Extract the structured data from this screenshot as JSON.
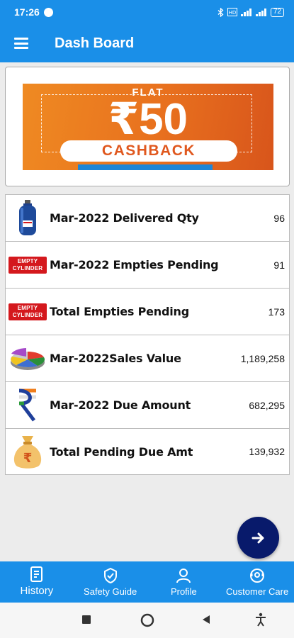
{
  "status": {
    "time": "17:26",
    "battery": "72"
  },
  "appbar": {
    "title": "Dash Board"
  },
  "banner": {
    "flat": "FLAT",
    "amount": "₹50",
    "cashback": "CASHBACK"
  },
  "empty_badge": {
    "line1": "EMPTY",
    "line2": "CYLINDER"
  },
  "rows": [
    {
      "label": "Mar-2022 Delivered Qty",
      "value": "96",
      "icon": "gas-cylinder-icon"
    },
    {
      "label": "Mar-2022 Empties Pending",
      "value": "91",
      "icon": "empty-cylinder-icon"
    },
    {
      "label": "Total Empties Pending",
      "value": "173",
      "icon": "empty-cylinder-icon"
    },
    {
      "label": "Mar-2022Sales Value",
      "value": "1,189,258",
      "icon": "pie-chart-icon"
    },
    {
      "label": "Mar-2022 Due Amount",
      "value": "682,295",
      "icon": "rupee-icon"
    },
    {
      "label": "Total Pending Due Amt",
      "value": "139,932",
      "icon": "money-bag-icon"
    }
  ],
  "bottom_nav": [
    {
      "label": "History",
      "icon": "history-icon"
    },
    {
      "label": "Safety Guide",
      "icon": "safety-guide-icon"
    },
    {
      "label": "Profile",
      "icon": "profile-icon"
    },
    {
      "label": "Customer Care",
      "icon": "customer-care-icon"
    }
  ],
  "colors": {
    "primary": "#1a8fe8",
    "fab": "#081a6b",
    "badge_red": "#d4181d",
    "banner_orange": "#e8701e"
  }
}
